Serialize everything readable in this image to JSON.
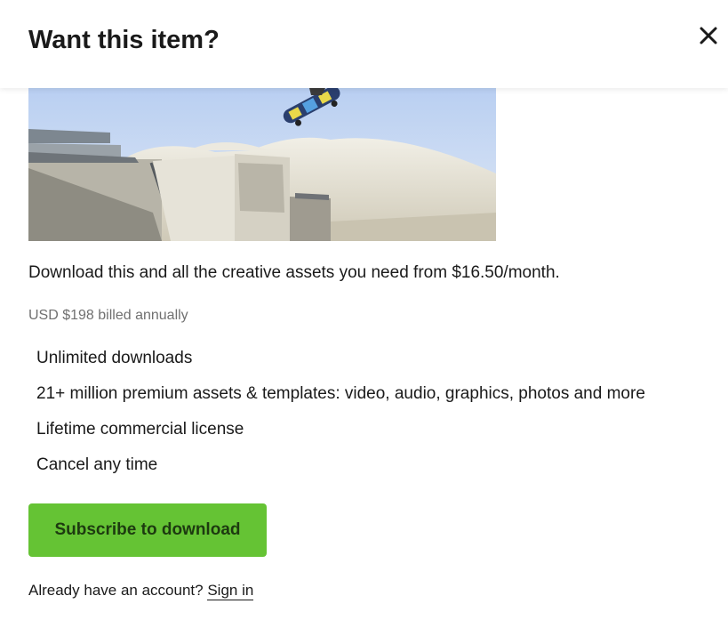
{
  "modal": {
    "title": "Want this item?",
    "close_icon": "close-icon"
  },
  "preview": {
    "icon": "skatepark-photo"
  },
  "offer": {
    "pitch": "Download this and all the creative assets you need from $16.50/month.",
    "billing": "USD $198 billed annually",
    "features": [
      "Unlimited downloads",
      "21+ million premium assets & templates: video, audio, graphics, photos and more",
      "Lifetime commercial license",
      "Cancel any time"
    ]
  },
  "actions": {
    "subscribe_label": "Subscribe to download",
    "account_prompt": "Already have an account?",
    "signin_label": "Sign in"
  },
  "colors": {
    "accent": "#65c334",
    "button_text": "#1d3a10",
    "muted_text": "#707070"
  }
}
